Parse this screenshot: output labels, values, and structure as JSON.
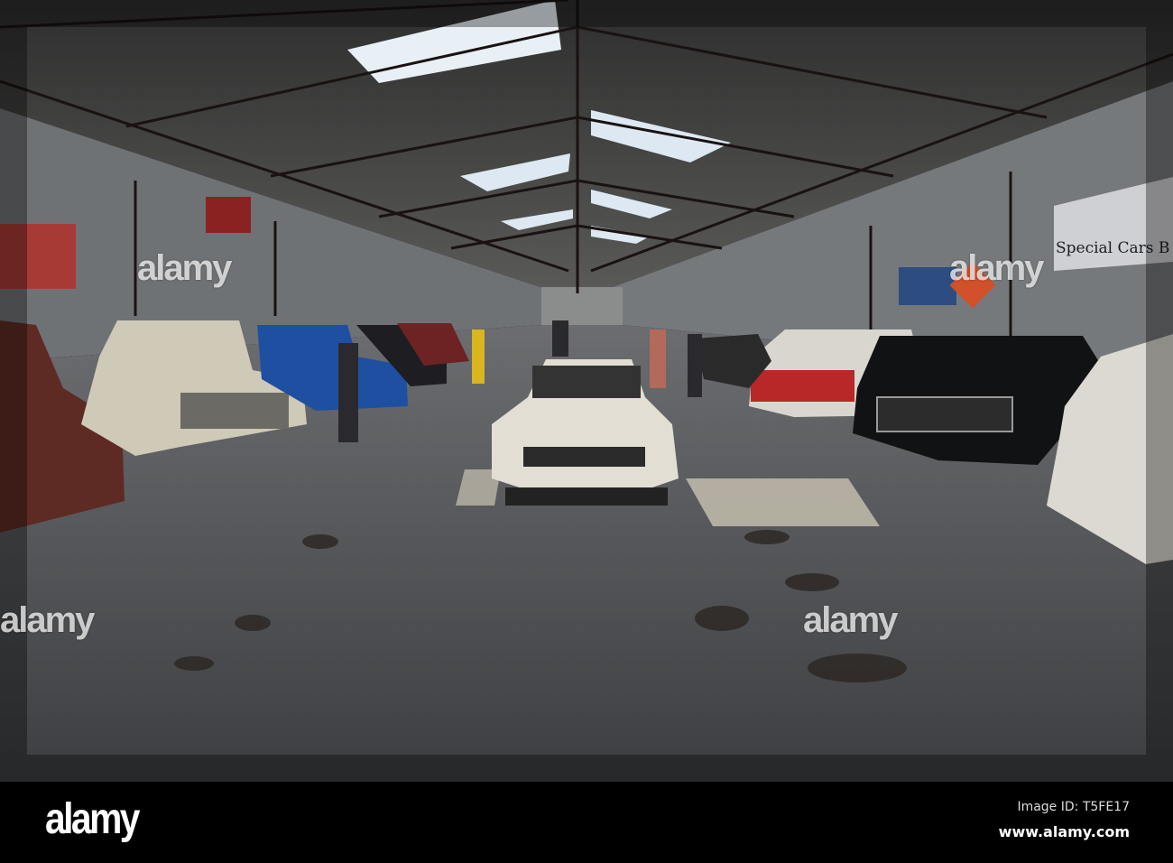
{
  "photo": {
    "subject": "Classic American cars and pickup trucks in a warehouse showroom",
    "banner_text": "Special Cars B",
    "watermark": "alamy"
  },
  "footer": {
    "logo": "alamy",
    "image_id": "Image ID: T5FE17",
    "url": "www.alamy.com"
  },
  "colors": {
    "roof": "#3a3a3a",
    "floor": "#55575a",
    "footer": "#000000"
  }
}
